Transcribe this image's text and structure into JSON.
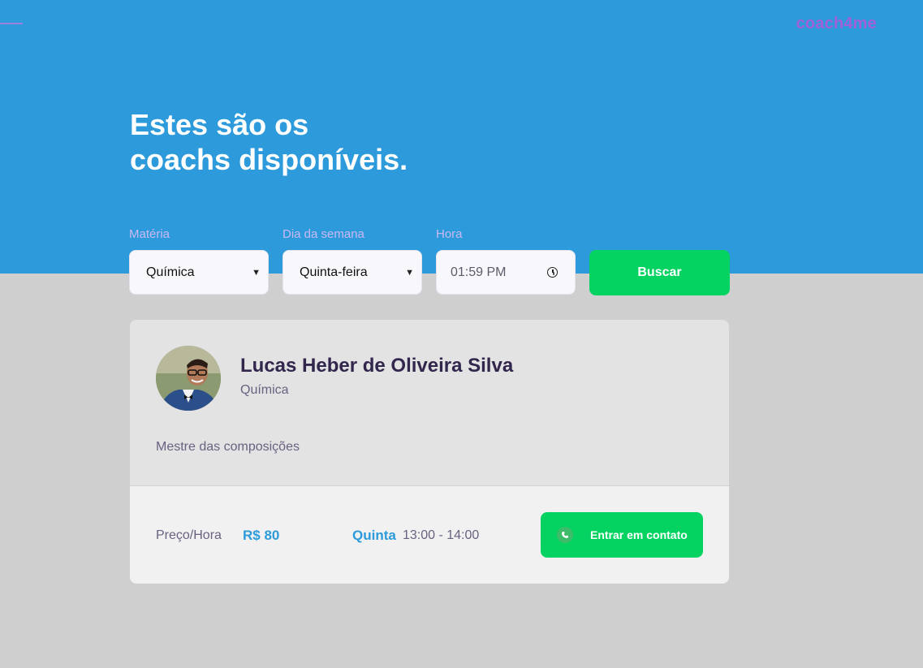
{
  "header": {
    "logo": "coach4me",
    "title_line1": "Estes são os",
    "title_line2": "coachs disponíveis."
  },
  "filters": {
    "subject": {
      "label": "Matéria",
      "value": "Química"
    },
    "weekday": {
      "label": "Dia da semana",
      "value": "Quinta-feira"
    },
    "time": {
      "label": "Hora",
      "value": "01:59 PM"
    },
    "search_label": "Buscar"
  },
  "coach": {
    "name": "Lucas Heber de Oliveira Silva",
    "subject": "Química",
    "bio": "Mestre das composições",
    "price_label": "Preço/Hora",
    "price_value": "R$ 80",
    "day": "Quinta",
    "hours": "13:00 - 14:00",
    "contact_label": "Entrar em contato"
  },
  "colors": {
    "hero": "#2d9bdb",
    "accent_green": "#04d361",
    "logo_purple": "#a060d8"
  }
}
